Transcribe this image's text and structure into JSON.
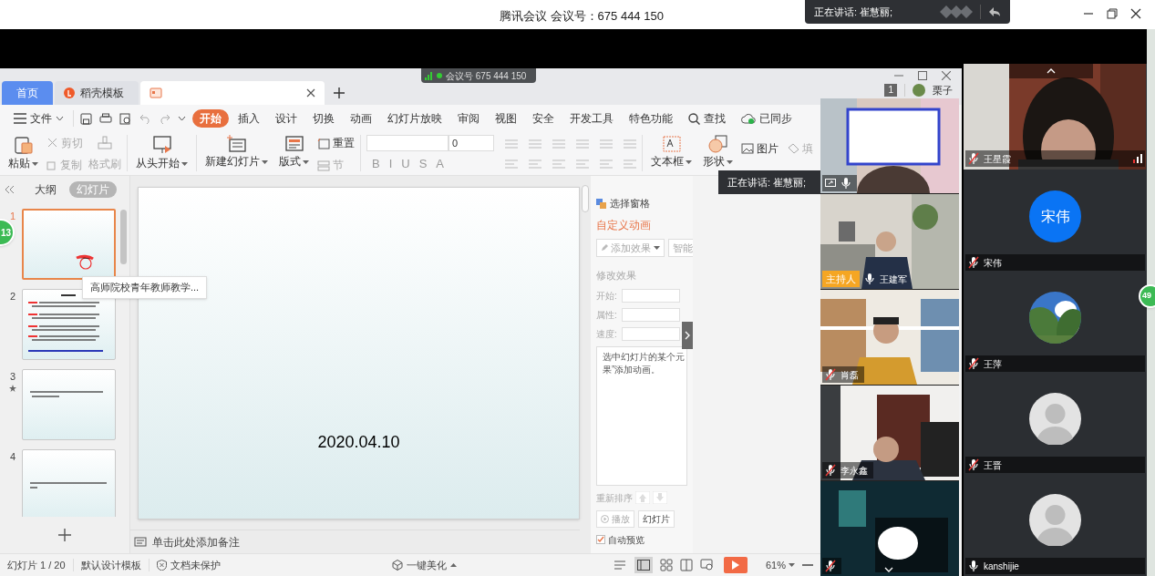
{
  "window": {
    "title": "腾讯会议 会议号：675 444 150"
  },
  "speaker_toast": {
    "text": "正在讲话: 崔慧丽;"
  },
  "meeting_badge": {
    "text": "会议号 675 444 150"
  },
  "wps": {
    "tabs": [
      {
        "label": "首页",
        "kind": "home",
        "selected": false
      },
      {
        "label": "稻壳模板",
        "kind": "docer",
        "selected": false
      },
      {
        "kind": "document",
        "selected": true
      }
    ],
    "page_count": "1",
    "user": "栗子",
    "menu": [
      {
        "label": "文件",
        "kind": "file",
        "selected": false
      },
      {
        "label": "开始",
        "kind": "tab",
        "selected": true
      },
      {
        "label": "插入",
        "kind": "tab",
        "selected": false
      },
      {
        "label": "设计",
        "kind": "tab",
        "selected": false
      },
      {
        "label": "切换",
        "kind": "tab",
        "selected": false
      },
      {
        "label": "动画",
        "kind": "tab",
        "selected": false
      },
      {
        "label": "幻灯片放映",
        "kind": "tab",
        "selected": false
      },
      {
        "label": "审阅",
        "kind": "tab",
        "selected": false
      },
      {
        "label": "视图",
        "kind": "tab",
        "selected": false
      },
      {
        "label": "安全",
        "kind": "tab",
        "selected": false
      },
      {
        "label": "开发工具",
        "kind": "tab",
        "selected": false
      },
      {
        "label": "特色功能",
        "kind": "tab",
        "selected": false
      },
      {
        "label": "查找",
        "kind": "search",
        "selected": false
      },
      {
        "label": "已同步",
        "kind": "sync",
        "selected": false
      }
    ],
    "ribbon": {
      "paste": "粘贴",
      "cut": {
        "label": "剪切",
        "disabled": true
      },
      "copy": {
        "label": "复制",
        "disabled": true
      },
      "format_painter": {
        "label": "格式刷",
        "disabled": true
      },
      "from_start": "从头开始",
      "new_slide": "新建幻灯片",
      "layout": "版式",
      "reset": {
        "label": "重置",
        "disabled": false
      },
      "section": {
        "label": "节",
        "disabled": true
      },
      "font_size": "0",
      "format_buttons": [
        "B",
        "I",
        "U",
        "S",
        "A"
      ],
      "text_box": "文本框",
      "shape": "形状",
      "picture": "图片",
      "fill": "填"
    },
    "panel_tabs": [
      {
        "label": "大纲",
        "selected": false
      },
      {
        "label": "幻灯片",
        "selected": true
      }
    ],
    "thumbnails": [
      {
        "number": "1",
        "selected": true,
        "animated": false
      },
      {
        "number": "2",
        "selected": false,
        "animated": false
      },
      {
        "number": "3",
        "selected": false,
        "animated": true
      },
      {
        "number": "4",
        "selected": false,
        "animated": false
      }
    ],
    "tooltip": "高师院校青年教师教学...",
    "slide": {
      "date": "2020.04.10"
    },
    "notes_placeholder": "单击此处添加备注",
    "task_pane": {
      "select_pane": "选择窗格",
      "title": "自定义动画",
      "add_effect": "添加效果",
      "smart": "智能",
      "modify": "修改效果",
      "fields": [
        "开始:",
        "属性:",
        "速度:"
      ],
      "hint_lines": [
        "选中幻灯片的某个元",
        "果”添加动画。"
      ],
      "reorder": "重新排序",
      "play": "播放",
      "slideshow": "幻灯片",
      "auto_preview": {
        "label": "自动预览",
        "checked": true
      }
    },
    "status_bar": {
      "slide": "幻灯片 1 / 20",
      "template": "默认设计模板",
      "protection": "文档未保护",
      "beautify": "一键美化",
      "zoom": "61%"
    }
  },
  "speaking_tooltip": "正在讲话: 崔慧丽;",
  "left_bubble": "13",
  "right_bubble": "49",
  "video_tiles": [
    {
      "kind": "sharing",
      "muted": false
    },
    {
      "kind": "host",
      "host_label": "主持人",
      "name": "王建军",
      "muted": false
    },
    {
      "kind": "video",
      "name": "肖磊",
      "muted": true
    },
    {
      "kind": "video",
      "name": "李永鑫",
      "muted": true
    },
    {
      "kind": "dark",
      "muted": true
    }
  ],
  "participants": [
    {
      "kind": "video",
      "name": "王星霞",
      "muted": true
    },
    {
      "kind": "initials",
      "initials": "宋伟",
      "name": "宋伟",
      "muted": true
    },
    {
      "name": "王萍",
      "muted": true
    },
    {
      "kind": "default",
      "name": "王晋",
      "muted": true
    },
    {
      "kind": "default",
      "name": "kanshijie",
      "muted": false
    }
  ]
}
